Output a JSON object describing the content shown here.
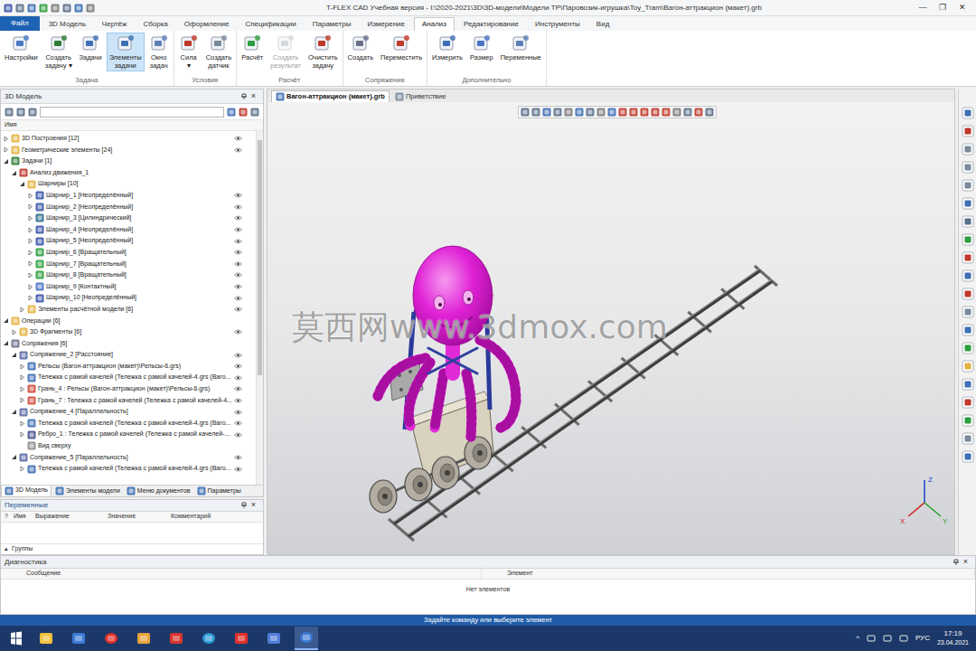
{
  "window": {
    "title": "T-FLEX CAD Учебная версия - I:\\2020-2021\\3D\\3D-модели\\Модели ТР\\Паровозик-игрушка\\Toy_Tram\\Вагон-аттракцион (макет).grb",
    "controls": [
      "—",
      "❐",
      "✕"
    ]
  },
  "menu": [
    {
      "label": "Файл",
      "selected": false,
      "kind": "file"
    },
    {
      "label": "3D Модель",
      "selected": false,
      "kind": "tab"
    },
    {
      "label": "Чертёж",
      "selected": false,
      "kind": "tab"
    },
    {
      "label": "Сборка",
      "selected": false,
      "kind": "tab"
    },
    {
      "label": "Оформление",
      "selected": false,
      "kind": "tab"
    },
    {
      "label": "Спецификации",
      "selected": false,
      "kind": "tab"
    },
    {
      "label": "Параметры",
      "selected": false,
      "kind": "tab"
    },
    {
      "label": "Измерение",
      "selected": false,
      "kind": "tab"
    },
    {
      "label": "Анализ",
      "selected": true,
      "kind": "tab"
    },
    {
      "label": "Редактирование",
      "selected": false,
      "kind": "tab"
    },
    {
      "label": "Инструменты",
      "selected": false,
      "kind": "tab"
    },
    {
      "label": "Вид",
      "selected": false,
      "kind": "tab"
    }
  ],
  "ribbon": [
    {
      "label": "Задача",
      "buttons": [
        {
          "label": "Настройки",
          "selected": false,
          "disabled": false
        },
        {
          "label": "Создать\nзадачу ▾",
          "selected": false,
          "disabled": false
        },
        {
          "label": "Задачи",
          "selected": false,
          "disabled": false
        },
        {
          "label": "Элементы\nзадачи",
          "selected": true,
          "disabled": false
        },
        {
          "label": "Окно\nзадач",
          "selected": false,
          "disabled": false
        }
      ]
    },
    {
      "label": "Условия",
      "buttons": [
        {
          "label": "Сила\n▾",
          "selected": false,
          "disabled": false
        },
        {
          "label": "Создать\nдатчик",
          "selected": false,
          "disabled": false
        }
      ]
    },
    {
      "label": "Расчёт",
      "buttons": [
        {
          "label": "Расчёт",
          "selected": false,
          "disabled": false
        },
        {
          "label": "Создать\nрезультат",
          "selected": false,
          "disabled": true
        },
        {
          "label": "Очистить\nзадачу",
          "selected": false,
          "disabled": false
        }
      ]
    },
    {
      "label": "Сопряжения",
      "buttons": [
        {
          "label": "Создать",
          "selected": false,
          "disabled": false
        },
        {
          "label": "Переместить",
          "selected": false,
          "disabled": false
        }
      ]
    },
    {
      "label": "Дополнительно",
      "buttons": [
        {
          "label": "Измерить",
          "selected": false,
          "disabled": false
        },
        {
          "label": "Размер",
          "selected": false,
          "disabled": false
        },
        {
          "label": "Переменные",
          "selected": false,
          "disabled": false
        }
      ]
    }
  ],
  "model_panel": {
    "title": "3D Модель",
    "close": "×",
    "column": "Имя",
    "tree": [
      {
        "label": "3D Построения [12]",
        "depth": 0,
        "has_children": true,
        "expanded": false,
        "kind": "folder",
        "eye": true
      },
      {
        "label": "Геометрические элементы [24]",
        "depth": 0,
        "has_children": true,
        "expanded": false,
        "kind": "folder",
        "eye": true
      },
      {
        "label": "Задачи [1]",
        "depth": 0,
        "has_children": true,
        "expanded": true,
        "kind": "task",
        "eye": false
      },
      {
        "label": "Анализ движения_1",
        "depth": 1,
        "has_children": true,
        "expanded": true,
        "kind": "analysis",
        "eye": false
      },
      {
        "label": "Шарниры [10]",
        "depth": 2,
        "has_children": true,
        "expanded": true,
        "kind": "folder",
        "eye": false
      },
      {
        "label": "Шарнир_1 [Неопределённый]",
        "depth": 3,
        "has_children": true,
        "expanded": false,
        "kind": "joint",
        "eye": true
      },
      {
        "label": "Шарнир_2 [Неопределённый]",
        "depth": 3,
        "has_children": true,
        "expanded": false,
        "kind": "joint",
        "eye": true
      },
      {
        "label": "Шарнир_3 [Цилиндрический]",
        "depth": 3,
        "has_children": true,
        "expanded": false,
        "kind": "joint-cyl",
        "eye": true
      },
      {
        "label": "Шарнир_4 [Неопределённый]",
        "depth": 3,
        "has_children": true,
        "expanded": false,
        "kind": "joint",
        "eye": true
      },
      {
        "label": "Шарнир_5 [Неопределённый]",
        "depth": 3,
        "has_children": true,
        "expanded": false,
        "kind": "joint",
        "eye": true
      },
      {
        "label": "Шарнир_6 [Вращательный]",
        "depth": 3,
        "has_children": true,
        "expanded": false,
        "kind": "joint-rot",
        "eye": true
      },
      {
        "label": "Шарнир_7 [Вращательный]",
        "depth": 3,
        "has_children": true,
        "expanded": false,
        "kind": "joint-rot",
        "eye": true
      },
      {
        "label": "Шарнир_8 [Вращательный]",
        "depth": 3,
        "has_children": true,
        "expanded": false,
        "kind": "joint-rot",
        "eye": true
      },
      {
        "label": "Шарнир_9 [Контактный]",
        "depth": 3,
        "has_children": true,
        "expanded": false,
        "kind": "joint-contact",
        "eye": true
      },
      {
        "label": "Шарнир_10 [Неопределённый]",
        "depth": 3,
        "has_children": true,
        "expanded": false,
        "kind": "joint",
        "eye": true
      },
      {
        "label": "Элементы расчётной модели [6]",
        "depth": 2,
        "has_children": true,
        "expanded": false,
        "kind": "folder",
        "eye": true
      },
      {
        "label": "Операции [6]",
        "depth": 0,
        "has_children": true,
        "expanded": true,
        "kind": "folder",
        "eye": false
      },
      {
        "label": "3D Фрагменты [6]",
        "depth": 1,
        "has_children": true,
        "expanded": false,
        "kind": "folder",
        "eye": true
      },
      {
        "label": "Сопряжения [6]",
        "depth": 0,
        "has_children": true,
        "expanded": true,
        "kind": "mates",
        "eye": false
      },
      {
        "label": "Сопряжение_2 [Расстояние]",
        "depth": 1,
        "has_children": true,
        "expanded": true,
        "kind": "mate",
        "eye": true
      },
      {
        "label": "Рельсы (Вагон-аттракцион (макет)\\Рельсы-6.grs)",
        "depth": 2,
        "has_children": true,
        "expanded": false,
        "kind": "part",
        "eye": true
      },
      {
        "label": "Тележка с рамой качелей (Тележка с рамой качелей-4.grs (Ваго...",
        "depth": 2,
        "has_children": true,
        "expanded": false,
        "kind": "part",
        "eye": true
      },
      {
        "label": "Грань_4 : Рельсы (Вагон-аттракцион (макет)\\Рельсы-6.grs)",
        "depth": 2,
        "has_children": true,
        "expanded": false,
        "kind": "face",
        "eye": true
      },
      {
        "label": "Грань_7 : Тележка с рамой качелей (Тележка с рамой качелей-4...",
        "depth": 2,
        "has_children": true,
        "expanded": false,
        "kind": "face",
        "eye": true
      },
      {
        "label": "Сопряжение_4 [Параллельность]",
        "depth": 1,
        "has_children": true,
        "expanded": true,
        "kind": "mate",
        "eye": true
      },
      {
        "label": "Тележка с рамой качелей (Тележка с рамой качелей-4.grs (Ваго...",
        "depth": 2,
        "has_children": true,
        "expanded": false,
        "kind": "part",
        "eye": true
      },
      {
        "label": "Ребро_1 : Тележка с рамой качелей (Тележка с рамой качелей-...",
        "depth": 2,
        "has_children": true,
        "expanded": false,
        "kind": "edge",
        "eye": true
      },
      {
        "label": "Вид сверху",
        "depth": 2,
        "has_children": false,
        "expanded": false,
        "kind": "view",
        "eye": false
      },
      {
        "label": "Сопряжение_5 [Параллельность]",
        "depth": 1,
        "has_children": true,
        "expanded": true,
        "kind": "mate",
        "eye": true
      },
      {
        "label": "Тележка с рамой качелей (Тележка с рамой качелей-4.grs (Ваго...",
        "depth": 2,
        "has_children": true,
        "expanded": false,
        "kind": "part",
        "eye": true
      }
    ],
    "tabs": [
      {
        "label": "3D Модель",
        "selected": true
      },
      {
        "label": "Элементы модели",
        "selected": false
      },
      {
        "label": "Меню документов",
        "selected": false
      },
      {
        "label": "Параметры",
        "selected": false
      }
    ]
  },
  "variables": {
    "title": "Переменные",
    "close": "×",
    "columns": [
      "?",
      "Имя",
      "Выражение",
      "Значение",
      "Комментарий"
    ],
    "group_toggle": "▴",
    "group": "Группы"
  },
  "viewport": {
    "tabs": [
      {
        "label": "Вагон-аттракцион (макет).grb",
        "selected": true
      },
      {
        "label": "Приветствие",
        "selected": false
      }
    ],
    "watermark": "莫西网www.3dmox.com",
    "axes": [
      "Z",
      "X",
      "Y"
    ]
  },
  "diagnostics": {
    "title": "Диагностика",
    "close": "×",
    "columns": [
      "Сообщение",
      "Элемент"
    ],
    "empty": "Нет элементов"
  },
  "status_bar": "Задайте команду или выберите элемент",
  "taskbar": {
    "tray_arrow": "^",
    "language": "РУС",
    "time": "17:19",
    "date": "23.04.2021"
  }
}
